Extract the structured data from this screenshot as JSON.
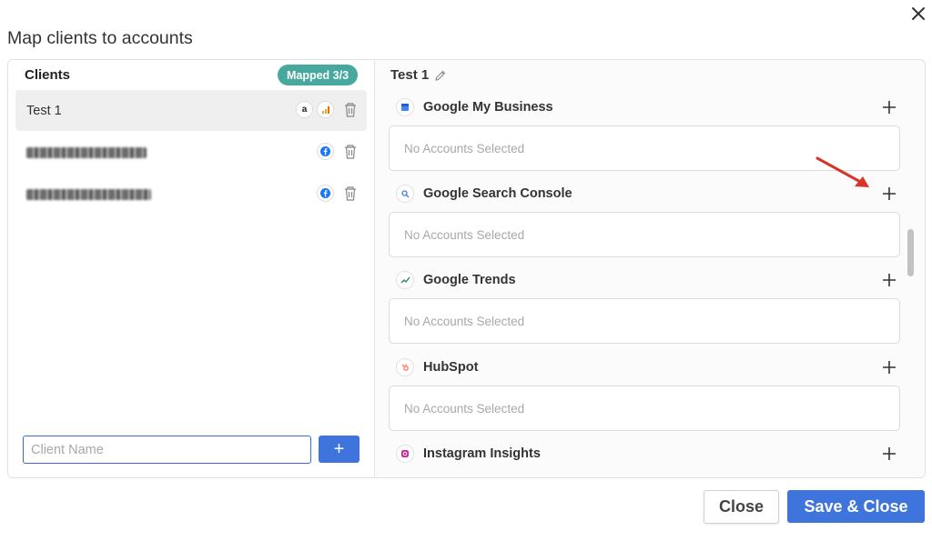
{
  "dialog": {
    "title": "Map clients to accounts",
    "close_button_icon": "close-icon"
  },
  "clients_panel": {
    "heading": "Clients",
    "mapped_badge": "Mapped 3/3",
    "clients": [
      {
        "name": "Test 1",
        "selected": true,
        "sources": [
          "amazon-icon",
          "analytics-icon"
        ]
      },
      {
        "name": "",
        "blurred": true,
        "selected": false,
        "sources": [
          "facebook-icon"
        ]
      },
      {
        "name": "",
        "blurred": true,
        "selected": false,
        "sources": [
          "facebook-icon"
        ]
      }
    ],
    "new_client_input": {
      "value": "",
      "placeholder": "Client Name"
    },
    "add_button_label": "+"
  },
  "mapping_panel": {
    "client_title": "Test 1",
    "sources": [
      {
        "name": "Google My Business",
        "icon": "google-my-business-icon",
        "accounts_text": "No Accounts Selected"
      },
      {
        "name": "Google Search Console",
        "icon": "google-search-console-icon",
        "accounts_text": "No Accounts Selected"
      },
      {
        "name": "Google Trends",
        "icon": "google-trends-icon",
        "accounts_text": "No Accounts Selected"
      },
      {
        "name": "HubSpot",
        "icon": "hubspot-icon",
        "accounts_text": "No Accounts Selected"
      },
      {
        "name": "Instagram Insights",
        "icon": "instagram-icon",
        "accounts_text": ""
      }
    ]
  },
  "footer": {
    "close_label": "Close",
    "save_label": "Save & Close"
  },
  "colors": {
    "accent": "#3f74dd",
    "badge": "#47a89e",
    "annotation_arrow": "#d9342b"
  }
}
